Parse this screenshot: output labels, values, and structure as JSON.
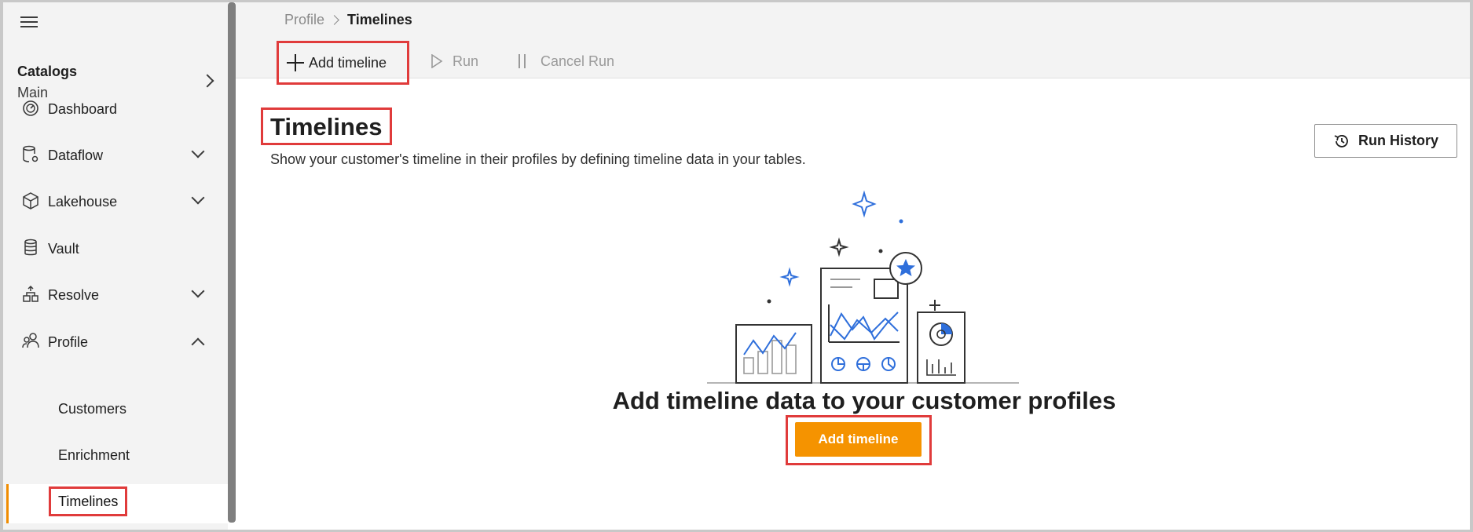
{
  "sidebar": {
    "menu_icon": "hamburger-icon",
    "catalog": {
      "title": "Catalogs",
      "value": "Main"
    },
    "items": [
      {
        "label": "Dashboard",
        "icon": "gauge-icon"
      },
      {
        "label": "Dataflow",
        "icon": "database-gear-icon"
      },
      {
        "label": "Lakehouse",
        "icon": "cube-icon"
      },
      {
        "label": "Vault",
        "icon": "database-icon"
      },
      {
        "label": "Resolve",
        "icon": "hierarchy-icon"
      },
      {
        "label": "Profile",
        "icon": "people-icon"
      }
    ],
    "sub_items": [
      {
        "label": "Customers"
      },
      {
        "label": "Enrichment"
      },
      {
        "label": "Timelines"
      }
    ]
  },
  "breadcrumb": {
    "parent": "Profile",
    "current": "Timelines"
  },
  "toolbar": {
    "add_label": "Add timeline",
    "run_label": "Run",
    "cancel_label": "Cancel Run"
  },
  "main": {
    "title": "Timelines",
    "description": "Show your customer's timeline in their profiles by defining timeline data in your tables.",
    "run_history_label": "Run History",
    "empty_title": "Add timeline data to your customer profiles",
    "cta_label": "Add timeline"
  },
  "colors": {
    "accent": "#f59300",
    "highlight": "#e03b3b",
    "illustration_blue": "#2f6fdb",
    "active_bar": "#f08c00"
  }
}
